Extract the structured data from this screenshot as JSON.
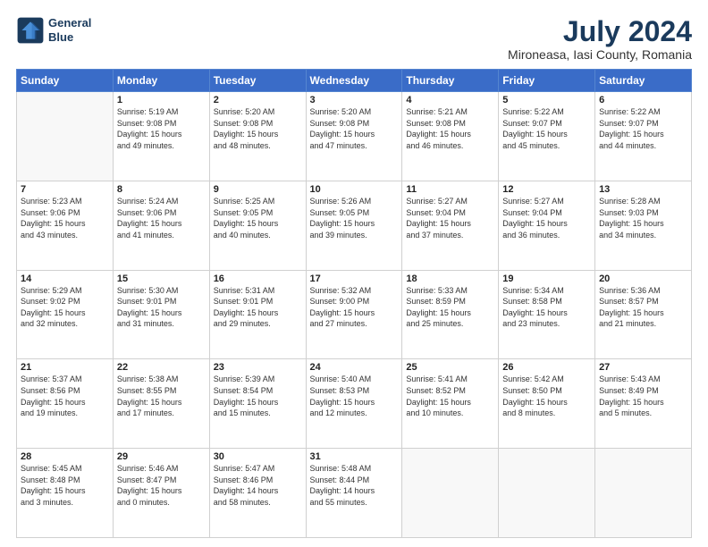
{
  "logo": {
    "line1": "General",
    "line2": "Blue"
  },
  "title": "July 2024",
  "subtitle": "Mironeasa, Iasi County, Romania",
  "days_header": [
    "Sunday",
    "Monday",
    "Tuesday",
    "Wednesday",
    "Thursday",
    "Friday",
    "Saturday"
  ],
  "weeks": [
    [
      {
        "day": "",
        "info": ""
      },
      {
        "day": "1",
        "info": "Sunrise: 5:19 AM\nSunset: 9:08 PM\nDaylight: 15 hours\nand 49 minutes."
      },
      {
        "day": "2",
        "info": "Sunrise: 5:20 AM\nSunset: 9:08 PM\nDaylight: 15 hours\nand 48 minutes."
      },
      {
        "day": "3",
        "info": "Sunrise: 5:20 AM\nSunset: 9:08 PM\nDaylight: 15 hours\nand 47 minutes."
      },
      {
        "day": "4",
        "info": "Sunrise: 5:21 AM\nSunset: 9:08 PM\nDaylight: 15 hours\nand 46 minutes."
      },
      {
        "day": "5",
        "info": "Sunrise: 5:22 AM\nSunset: 9:07 PM\nDaylight: 15 hours\nand 45 minutes."
      },
      {
        "day": "6",
        "info": "Sunrise: 5:22 AM\nSunset: 9:07 PM\nDaylight: 15 hours\nand 44 minutes."
      }
    ],
    [
      {
        "day": "7",
        "info": "Sunrise: 5:23 AM\nSunset: 9:06 PM\nDaylight: 15 hours\nand 43 minutes."
      },
      {
        "day": "8",
        "info": "Sunrise: 5:24 AM\nSunset: 9:06 PM\nDaylight: 15 hours\nand 41 minutes."
      },
      {
        "day": "9",
        "info": "Sunrise: 5:25 AM\nSunset: 9:05 PM\nDaylight: 15 hours\nand 40 minutes."
      },
      {
        "day": "10",
        "info": "Sunrise: 5:26 AM\nSunset: 9:05 PM\nDaylight: 15 hours\nand 39 minutes."
      },
      {
        "day": "11",
        "info": "Sunrise: 5:27 AM\nSunset: 9:04 PM\nDaylight: 15 hours\nand 37 minutes."
      },
      {
        "day": "12",
        "info": "Sunrise: 5:27 AM\nSunset: 9:04 PM\nDaylight: 15 hours\nand 36 minutes."
      },
      {
        "day": "13",
        "info": "Sunrise: 5:28 AM\nSunset: 9:03 PM\nDaylight: 15 hours\nand 34 minutes."
      }
    ],
    [
      {
        "day": "14",
        "info": "Sunrise: 5:29 AM\nSunset: 9:02 PM\nDaylight: 15 hours\nand 32 minutes."
      },
      {
        "day": "15",
        "info": "Sunrise: 5:30 AM\nSunset: 9:01 PM\nDaylight: 15 hours\nand 31 minutes."
      },
      {
        "day": "16",
        "info": "Sunrise: 5:31 AM\nSunset: 9:01 PM\nDaylight: 15 hours\nand 29 minutes."
      },
      {
        "day": "17",
        "info": "Sunrise: 5:32 AM\nSunset: 9:00 PM\nDaylight: 15 hours\nand 27 minutes."
      },
      {
        "day": "18",
        "info": "Sunrise: 5:33 AM\nSunset: 8:59 PM\nDaylight: 15 hours\nand 25 minutes."
      },
      {
        "day": "19",
        "info": "Sunrise: 5:34 AM\nSunset: 8:58 PM\nDaylight: 15 hours\nand 23 minutes."
      },
      {
        "day": "20",
        "info": "Sunrise: 5:36 AM\nSunset: 8:57 PM\nDaylight: 15 hours\nand 21 minutes."
      }
    ],
    [
      {
        "day": "21",
        "info": "Sunrise: 5:37 AM\nSunset: 8:56 PM\nDaylight: 15 hours\nand 19 minutes."
      },
      {
        "day": "22",
        "info": "Sunrise: 5:38 AM\nSunset: 8:55 PM\nDaylight: 15 hours\nand 17 minutes."
      },
      {
        "day": "23",
        "info": "Sunrise: 5:39 AM\nSunset: 8:54 PM\nDaylight: 15 hours\nand 15 minutes."
      },
      {
        "day": "24",
        "info": "Sunrise: 5:40 AM\nSunset: 8:53 PM\nDaylight: 15 hours\nand 12 minutes."
      },
      {
        "day": "25",
        "info": "Sunrise: 5:41 AM\nSunset: 8:52 PM\nDaylight: 15 hours\nand 10 minutes."
      },
      {
        "day": "26",
        "info": "Sunrise: 5:42 AM\nSunset: 8:50 PM\nDaylight: 15 hours\nand 8 minutes."
      },
      {
        "day": "27",
        "info": "Sunrise: 5:43 AM\nSunset: 8:49 PM\nDaylight: 15 hours\nand 5 minutes."
      }
    ],
    [
      {
        "day": "28",
        "info": "Sunrise: 5:45 AM\nSunset: 8:48 PM\nDaylight: 15 hours\nand 3 minutes."
      },
      {
        "day": "29",
        "info": "Sunrise: 5:46 AM\nSunset: 8:47 PM\nDaylight: 15 hours\nand 0 minutes."
      },
      {
        "day": "30",
        "info": "Sunrise: 5:47 AM\nSunset: 8:46 PM\nDaylight: 14 hours\nand 58 minutes."
      },
      {
        "day": "31",
        "info": "Sunrise: 5:48 AM\nSunset: 8:44 PM\nDaylight: 14 hours\nand 55 minutes."
      },
      {
        "day": "",
        "info": ""
      },
      {
        "day": "",
        "info": ""
      },
      {
        "day": "",
        "info": ""
      }
    ]
  ]
}
